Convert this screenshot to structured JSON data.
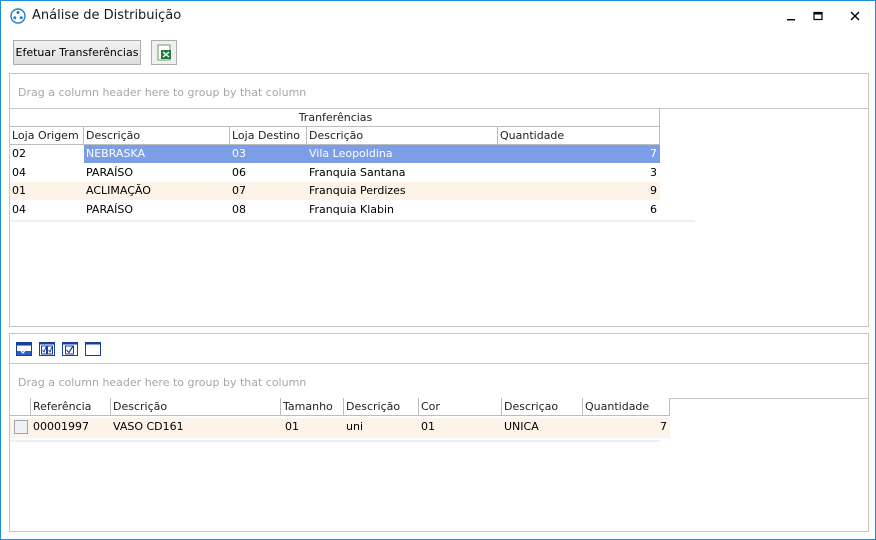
{
  "window": {
    "title": "Análise de Distribuição"
  },
  "toolbar": {
    "transfer_label": "Efetuar Transferências",
    "excel_icon": "excel-export-icon"
  },
  "top_grid": {
    "group_hint": "Drag a column header here to group by that column",
    "band_title": "Tranferências",
    "columns": [
      "Loja Origem",
      "Descrição",
      "Loja Destino",
      "Descrição",
      "Quantidade"
    ],
    "rows": [
      [
        "02",
        "NEBRASKA",
        "03",
        "Vila Leopoldina",
        "7"
      ],
      [
        "04",
        "PARAÍSO",
        "06",
        "Franquia Santana",
        "3"
      ],
      [
        "01",
        "ACLIMAÇÃO",
        "07",
        "Franquia Perdizes",
        "9"
      ],
      [
        "04",
        "PARAÍSO",
        "08",
        "Franquia Klabin",
        "6"
      ]
    ],
    "selected_color": "#7b9ee6",
    "alt_color": "#fdf3e8"
  },
  "bottom_grid": {
    "group_hint": "Drag a column header here to group by that column",
    "columns": [
      "Referência",
      "Descrição",
      "Tamanho",
      "Descrição",
      "Cor",
      "Descriçao",
      "Quantidade"
    ],
    "rows": [
      [
        "00001997",
        "VASO CD161",
        "01",
        "uni",
        "01",
        "UNICA",
        "7"
      ]
    ]
  }
}
